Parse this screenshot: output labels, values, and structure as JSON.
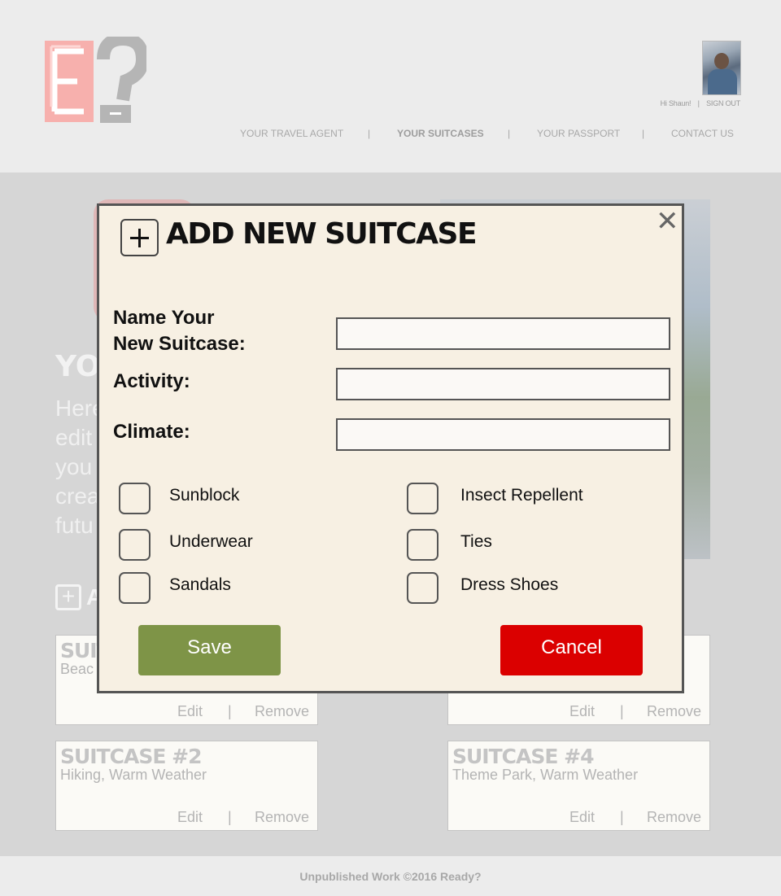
{
  "header": {
    "logo_alt": "E?",
    "user": {
      "greeting": "Hi Shaun!",
      "separator": "|",
      "signout": "SIGN OUT"
    },
    "nav": [
      {
        "label": "YOUR TRAVEL AGENT",
        "active": false
      },
      {
        "label": "|"
      },
      {
        "label": "YOUR SUITCASES",
        "active": true
      },
      {
        "label": "|"
      },
      {
        "label": "YOUR PASSPORT",
        "active": false
      },
      {
        "label": "|"
      },
      {
        "label": "CONTACT US",
        "active": false
      }
    ]
  },
  "background": {
    "title": "YO",
    "text": "Here\nedit\nyou\ncrea\nfutu",
    "add_label": "A",
    "cards": [
      {
        "title": "SUIT",
        "desc": "Beac",
        "edit": "Edit",
        "sep": "|",
        "remove": "Remove"
      },
      {
        "title": "",
        "desc": "",
        "edit": "Edit",
        "sep": "|",
        "remove": "Remove"
      },
      {
        "title": "SUITCASE #2",
        "desc": "Hiking, Warm Weather",
        "edit": "Edit",
        "sep": "|",
        "remove": "Remove"
      },
      {
        "title": "SUITCASE #4",
        "desc": "Theme Park, Warm Weather",
        "edit": "Edit",
        "sep": "|",
        "remove": "Remove"
      }
    ]
  },
  "modal": {
    "title": "ADD NEW SUITCASE",
    "close_icon": "close-icon",
    "fields": [
      {
        "label": "Name Your\nNew  Suitcase:",
        "value": ""
      },
      {
        "label": "Activity:",
        "value": ""
      },
      {
        "label": "Climate:",
        "value": ""
      }
    ],
    "checkboxes": [
      {
        "label": "Sunblock",
        "checked": false
      },
      {
        "label": "Insect Repellent",
        "checked": false
      },
      {
        "label": "Underwear",
        "checked": false
      },
      {
        "label": "Ties",
        "checked": false
      },
      {
        "label": "Sandals",
        "checked": false
      },
      {
        "label": "Dress Shoes",
        "checked": false
      }
    ],
    "save_label": "Save",
    "cancel_label": "Cancel",
    "colors": {
      "save": "#7e9447",
      "cancel": "#db0000",
      "panel": "#f7f0e3"
    }
  },
  "footer": {
    "text": "Unpublished Work ©2016 Ready?"
  }
}
